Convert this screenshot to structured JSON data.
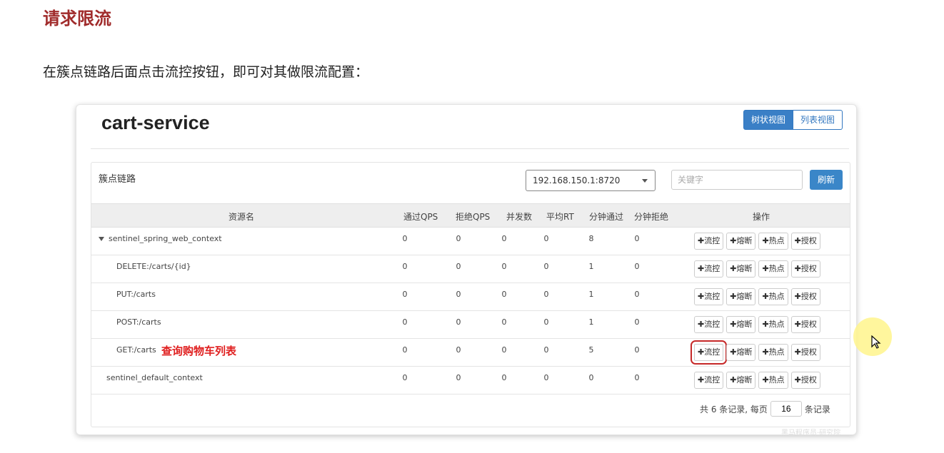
{
  "doc": {
    "title": "请求限流",
    "paragraph": "在簇点链路后面点击流控按钮，即可对其做限流配置："
  },
  "service": {
    "name": "cart-service"
  },
  "view_toggle": {
    "tree": "树状视图",
    "list": "列表视图"
  },
  "section_label": "簇点链路",
  "machine_select": {
    "value": "192.168.150.1:8720"
  },
  "search": {
    "placeholder": "关键字"
  },
  "refresh_label": "刷新",
  "table": {
    "headers": [
      "资源名",
      "通过QPS",
      "拒绝QPS",
      "并发数",
      "平均RT",
      "分钟通过",
      "分钟拒绝",
      "操作"
    ],
    "rows": [
      {
        "name": "sentinel_spring_web_context",
        "pass_qps": "0",
        "block_qps": "0",
        "threads": "0",
        "avg_rt": "0",
        "minute_pass": "8",
        "minute_block": "0"
      },
      {
        "name": "DELETE:/carts/{id}",
        "pass_qps": "0",
        "block_qps": "0",
        "threads": "0",
        "avg_rt": "0",
        "minute_pass": "1",
        "minute_block": "0"
      },
      {
        "name": "PUT:/carts",
        "pass_qps": "0",
        "block_qps": "0",
        "threads": "0",
        "avg_rt": "0",
        "minute_pass": "1",
        "minute_block": "0"
      },
      {
        "name": "POST:/carts",
        "pass_qps": "0",
        "block_qps": "0",
        "threads": "0",
        "avg_rt": "0",
        "minute_pass": "1",
        "minute_block": "0"
      },
      {
        "name": "GET:/carts",
        "note": "查询购物车列表",
        "pass_qps": "0",
        "block_qps": "0",
        "threads": "0",
        "avg_rt": "0",
        "minute_pass": "5",
        "minute_block": "0"
      },
      {
        "name": "sentinel_default_context",
        "pass_qps": "0",
        "block_qps": "0",
        "threads": "0",
        "avg_rt": "0",
        "minute_pass": "0",
        "minute_block": "0"
      }
    ],
    "actions": [
      "✚流控",
      "✚熔断",
      "✚热点",
      "✚授权"
    ]
  },
  "pager": {
    "prefix": "共 6 条记录, 每页",
    "page_size": "16",
    "suffix": "条记录"
  },
  "watermark": "黑马程序员·研究院"
}
